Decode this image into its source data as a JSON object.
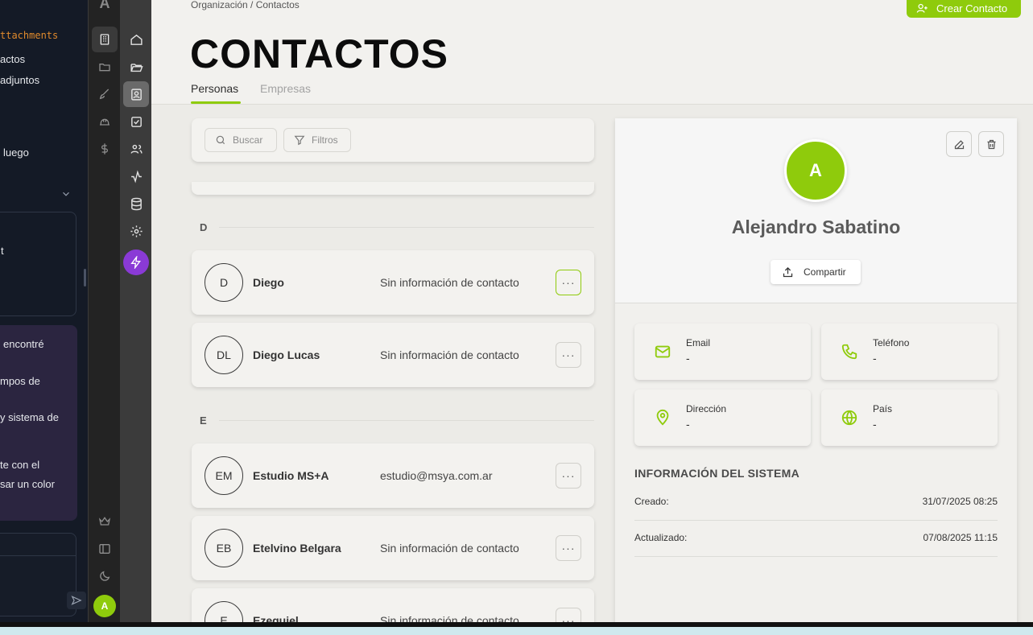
{
  "side_panel": {
    "lines": [
      "ttachments",
      "actos",
      "adjuntos",
      "luego",
      "t",
      "encontré",
      "mpos de",
      "y sistema de",
      "te con el",
      "sar un color"
    ]
  },
  "rail": {
    "logo": "A",
    "avatar_initial": "A"
  },
  "header": {
    "breadcrumb": "Organización / Contactos",
    "title": "CONTACTOS",
    "create_button": "Crear Contacto",
    "tabs": [
      {
        "label": "Personas",
        "active": true
      },
      {
        "label": "Empresas",
        "active": false
      }
    ]
  },
  "toolbar": {
    "search_label": "Buscar",
    "filter_label": "Filtros"
  },
  "sections": [
    {
      "letter": "D",
      "contacts": [
        {
          "initials": "D",
          "name": "Diego",
          "info": "Sin información de contacto",
          "menu": "···"
        },
        {
          "initials": "DL",
          "name": "Diego Lucas",
          "info": "Sin información de contacto",
          "menu": "···"
        }
      ]
    },
    {
      "letter": "E",
      "contacts": [
        {
          "initials": "EM",
          "name": "Estudio MS+A",
          "info": "estudio@msya.com.ar",
          "menu": "···"
        },
        {
          "initials": "EB",
          "name": "Etelvino Belgara",
          "info": "Sin información de contacto",
          "menu": "···"
        },
        {
          "initials": "E",
          "name": "Ezequiel",
          "info": "Sin información de contacto",
          "menu": "···"
        }
      ]
    }
  ],
  "detail": {
    "avatar_initial": "A",
    "name": "Alejandro Sabatino",
    "share_label": "Compartir",
    "fields": [
      {
        "label": "Email",
        "value": "-",
        "icon": "mail-icon"
      },
      {
        "label": "Teléfono",
        "value": "-",
        "icon": "phone-icon"
      },
      {
        "label": "Dirección",
        "value": "-",
        "icon": "map-pin-icon"
      },
      {
        "label": "País",
        "value": "-",
        "icon": "globe-icon"
      }
    ],
    "system_title": "INFORMACIÓN DEL SISTEMA",
    "system": [
      {
        "label": "Creado:",
        "value": "31/07/2025 08:25"
      },
      {
        "label": "Actualizado:",
        "value": "07/08/2025 11:15"
      }
    ]
  },
  "colors": {
    "accent": "#8fcb0c",
    "bolt": "#8a3ad6"
  }
}
